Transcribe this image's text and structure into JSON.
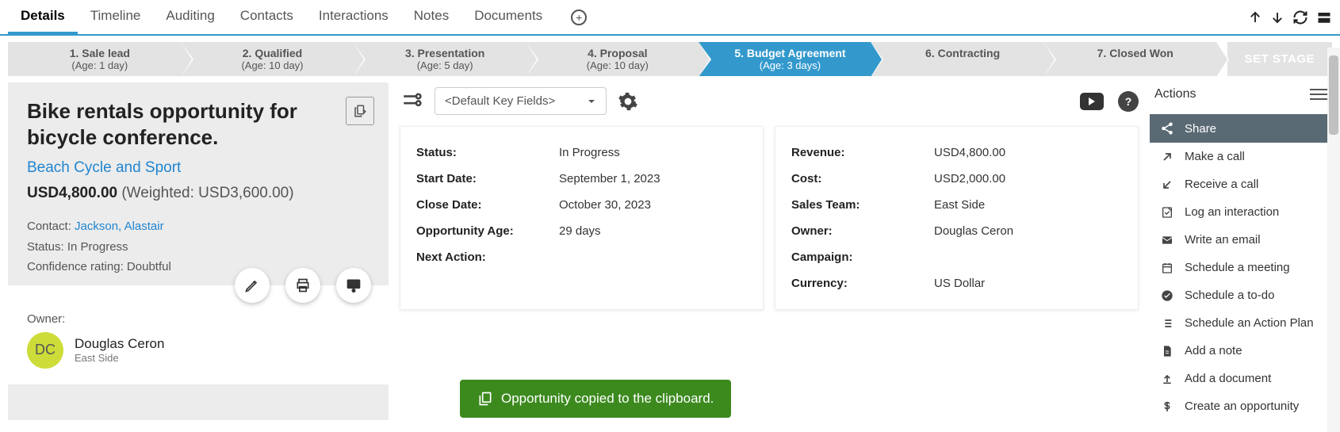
{
  "tabs": [
    "Details",
    "Timeline",
    "Auditing",
    "Contacts",
    "Interactions",
    "Notes",
    "Documents"
  ],
  "active_tab": 0,
  "stages": [
    {
      "title": "1. Sale lead",
      "age": "(Age: 1 day)"
    },
    {
      "title": "2. Qualified",
      "age": "(Age: 10 day)"
    },
    {
      "title": "3. Presentation",
      "age": "(Age: 5 day)"
    },
    {
      "title": "4. Proposal",
      "age": "(Age: 10 day)"
    },
    {
      "title": "5. Budget Agreement",
      "age": "(Age: 3 days)"
    },
    {
      "title": "6. Contracting",
      "age": ""
    },
    {
      "title": "7. Closed Won",
      "age": ""
    }
  ],
  "active_stage": 4,
  "set_stage_label": "SET STAGE",
  "opportunity": {
    "title": "Bike rentals opportunity for bicycle conference.",
    "account": "Beach Cycle and Sport",
    "amount": "USD4,800.00",
    "weighted_label": "(Weighted: USD3,600.00)",
    "contact_label": "Contact: ",
    "contact_name": "Jackson, Alastair",
    "status_label": "Status: ",
    "status_value": "In Progress",
    "confidence_label": "Confidence rating: ",
    "confidence_value": "Doubtful",
    "owner_label": "Owner:",
    "owner_initials": "DC",
    "owner_name": "Douglas Ceron",
    "owner_team": "East Side"
  },
  "key_fields_placeholder": "<Default Key Fields>",
  "card_left": {
    "status_l": "Status:",
    "status_v": "In Progress",
    "start_l": "Start Date:",
    "start_v": "September 1, 2023",
    "close_l": "Close Date:",
    "close_v": "October 30, 2023",
    "age_l": "Opportunity Age:",
    "age_v": "29 days",
    "next_l": "Next Action:",
    "next_v": ""
  },
  "card_right": {
    "rev_l": "Revenue:",
    "rev_v": "USD4,800.00",
    "cost_l": "Cost:",
    "cost_v": "USD2,000.00",
    "team_l": "Sales Team:",
    "team_v": "East Side",
    "owner_l": "Owner:",
    "owner_v": "Douglas Ceron",
    "camp_l": "Campaign:",
    "camp_v": "",
    "curr_l": "Currency:",
    "curr_v": "US Dollar"
  },
  "actions_title": "Actions",
  "actions": [
    {
      "icon": "share",
      "label": "Share",
      "active": true
    },
    {
      "icon": "arrow-ur",
      "label": "Make a call"
    },
    {
      "icon": "arrow-dl",
      "label": "Receive a call"
    },
    {
      "icon": "note",
      "label": "Log an interaction"
    },
    {
      "icon": "mail",
      "label": "Write an email"
    },
    {
      "icon": "calendar",
      "label": "Schedule a meeting"
    },
    {
      "icon": "check",
      "label": "Schedule a to-do"
    },
    {
      "icon": "list",
      "label": "Schedule an Action Plan"
    },
    {
      "icon": "doc",
      "label": "Add a note"
    },
    {
      "icon": "upload",
      "label": "Add a document"
    },
    {
      "icon": "dollar",
      "label": "Create an opportunity"
    }
  ],
  "toast": "Opportunity copied to the clipboard."
}
